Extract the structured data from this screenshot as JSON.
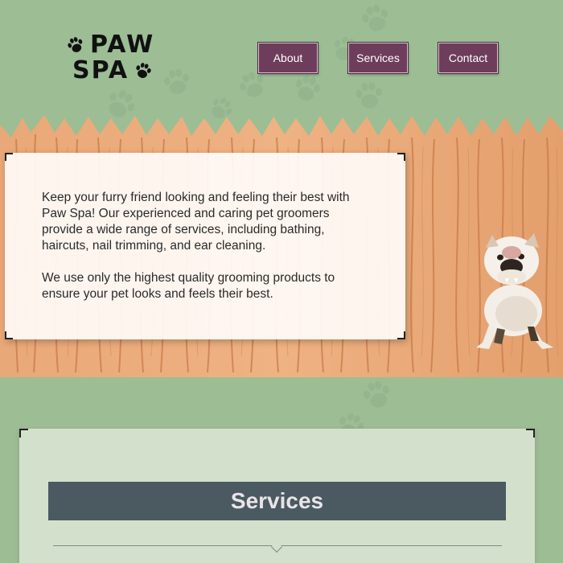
{
  "logo": {
    "line1": "PAW",
    "line2": "SPA",
    "paw_icon": "paw-icon"
  },
  "nav": {
    "items": [
      {
        "label": "About"
      },
      {
        "label": "Services"
      },
      {
        "label": "Contact"
      }
    ]
  },
  "intro": {
    "paragraph1": "Keep your furry friend looking and feeling their best with Paw Spa! Our experienced and caring pet groomers provide a wide range of services, including bathing, haircuts, nail trimming, and ear cleaning.",
    "paragraph2": "We use only the highest quality grooming products to ensure your pet looks and feels their best."
  },
  "services": {
    "title": "Services"
  },
  "colors": {
    "background": "#9dbd95",
    "nav_button": "#6e3d5b",
    "fence_wood": "#e9a877",
    "services_panel": "#d3e1cc",
    "services_title_bar": "#4a5a60"
  }
}
